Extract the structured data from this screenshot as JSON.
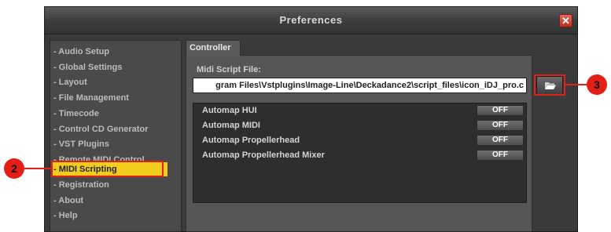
{
  "window": {
    "title": "Preferences",
    "close_symbol": "✕"
  },
  "sidebar": {
    "items": [
      {
        "label": "- Audio Setup"
      },
      {
        "label": "- Global Settings"
      },
      {
        "label": "- Layout"
      },
      {
        "label": "- File Management"
      },
      {
        "label": "- Timecode"
      },
      {
        "label": "- Control CD Generator"
      },
      {
        "label": "- VST Plugins"
      },
      {
        "label": "- Remote MIDI Control"
      },
      {
        "label": "- MIDI Scripting",
        "active": true
      },
      {
        "label": "- Registration"
      },
      {
        "label": "- About"
      },
      {
        "label": "- Help"
      }
    ]
  },
  "main": {
    "tab_label": "Controller",
    "script_file_label": "Midi Script File:",
    "script_file_value": "gram Files\\Vstplugins\\Image-Line\\Deckadance2\\script_files\\icon_iDJ_pro.c",
    "browse_icon": "folder-open-icon",
    "automap": [
      {
        "label": "Automap HUI",
        "state": "OFF"
      },
      {
        "label": "Automap MIDI",
        "state": "OFF"
      },
      {
        "label": "Automap Propellerhead",
        "state": "OFF"
      },
      {
        "label": "Automap Propellerhead Mixer",
        "state": "OFF"
      }
    ]
  },
  "annotations": [
    {
      "number": "2"
    },
    {
      "number": "3"
    }
  ],
  "colors": {
    "active_item": "#f2cc1c",
    "callout": "#e41f17",
    "close_button": "#c8402e"
  }
}
